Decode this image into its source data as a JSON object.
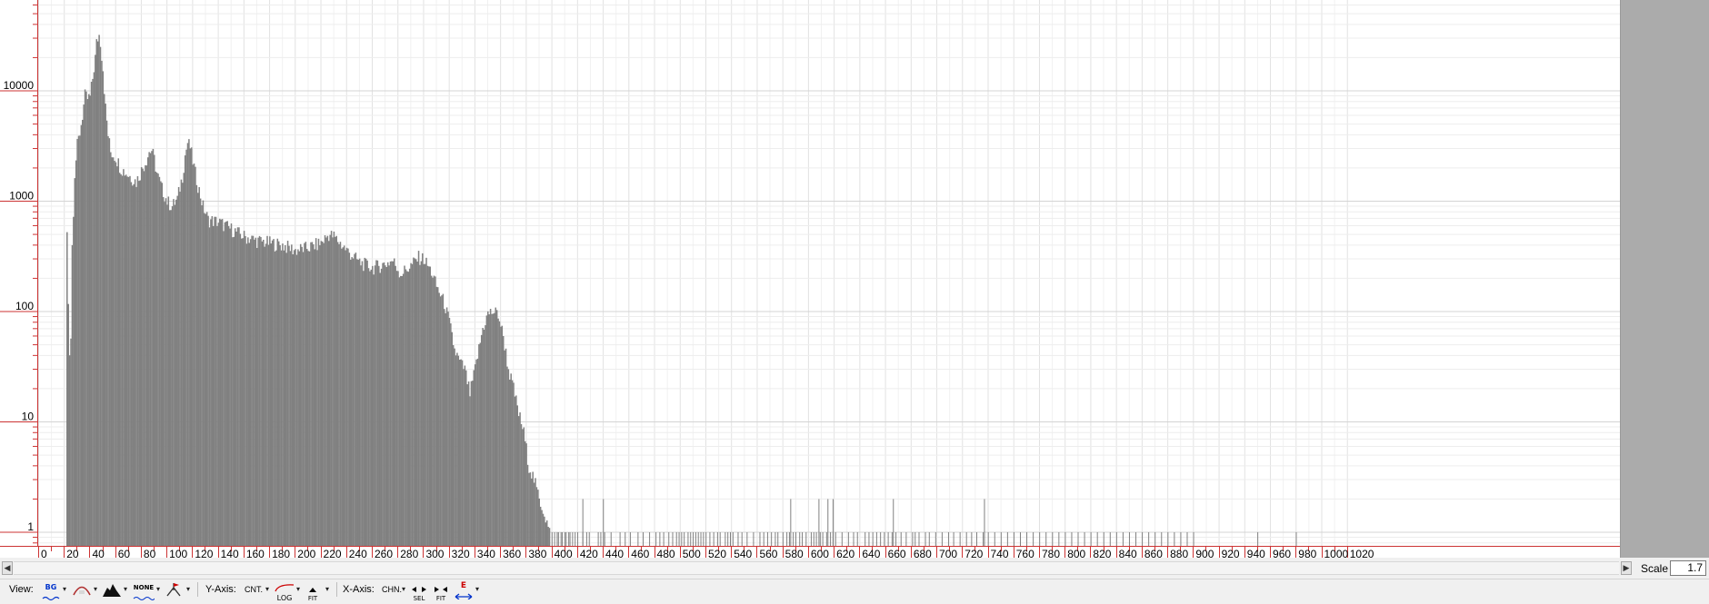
{
  "chart_data": {
    "type": "bar",
    "y_scale": "log",
    "ylim": [
      0.6,
      70000
    ],
    "xlim": [
      0,
      1020
    ],
    "grid": true,
    "bar_color": "#808080",
    "xticks": [
      "0",
      "20",
      "40",
      "60",
      "80",
      "100",
      "120",
      "140",
      "160",
      "180",
      "200",
      "220",
      "240",
      "260",
      "280",
      "300",
      "320",
      "340",
      "360",
      "380",
      "400",
      "420",
      "440",
      "460",
      "480",
      "500",
      "520",
      "540",
      "560",
      "580",
      "600",
      "620",
      "640",
      "660",
      "680",
      "700",
      "720",
      "740",
      "760",
      "780",
      "800",
      "820",
      "840",
      "860",
      "880",
      "900",
      "920",
      "940",
      "960",
      "980",
      "1000",
      "1020"
    ],
    "yticks": [
      "10000",
      "1000",
      "100",
      "10",
      "1"
    ],
    "profile": [
      [
        22,
        500
      ],
      [
        23,
        120
      ],
      [
        24,
        45
      ],
      [
        25,
        60
      ],
      [
        26,
        400
      ],
      [
        28,
        1800
      ],
      [
        30,
        3200
      ],
      [
        32,
        4200
      ],
      [
        34,
        6000
      ],
      [
        36,
        9000
      ],
      [
        38,
        8500
      ],
      [
        40,
        8800
      ],
      [
        42,
        13000
      ],
      [
        44,
        20000
      ],
      [
        45,
        27000
      ],
      [
        46,
        30000
      ],
      [
        47,
        32000
      ],
      [
        48,
        28000
      ],
      [
        50,
        16000
      ],
      [
        52,
        7000
      ],
      [
        54,
        4000
      ],
      [
        56,
        2800
      ],
      [
        60,
        2500
      ],
      [
        64,
        2000
      ],
      [
        68,
        1800
      ],
      [
        72,
        1650
      ],
      [
        76,
        1500
      ],
      [
        80,
        1900
      ],
      [
        84,
        2400
      ],
      [
        86,
        2800
      ],
      [
        88,
        2900
      ],
      [
        90,
        2400
      ],
      [
        92,
        1800
      ],
      [
        96,
        1300
      ],
      [
        100,
        1000
      ],
      [
        104,
        900
      ],
      [
        108,
        1050
      ],
      [
        112,
        1700
      ],
      [
        114,
        2600
      ],
      [
        116,
        3400
      ],
      [
        118,
        3100
      ],
      [
        120,
        2300
      ],
      [
        124,
        1400
      ],
      [
        128,
        900
      ],
      [
        132,
        680
      ],
      [
        140,
        650
      ],
      [
        150,
        560
      ],
      [
        160,
        480
      ],
      [
        170,
        440
      ],
      [
        180,
        420
      ],
      [
        190,
        400
      ],
      [
        200,
        360
      ],
      [
        210,
        380
      ],
      [
        220,
        420
      ],
      [
        226,
        500
      ],
      [
        230,
        480
      ],
      [
        240,
        360
      ],
      [
        250,
        280
      ],
      [
        260,
        250
      ],
      [
        270,
        270
      ],
      [
        276,
        290
      ],
      [
        282,
        220
      ],
      [
        290,
        260
      ],
      [
        296,
        310
      ],
      [
        300,
        300
      ],
      [
        306,
        230
      ],
      [
        310,
        170
      ],
      [
        316,
        120
      ],
      [
        320,
        80
      ],
      [
        324,
        45
      ],
      [
        328,
        35
      ],
      [
        332,
        30
      ],
      [
        336,
        18
      ],
      [
        340,
        30
      ],
      [
        346,
        70
      ],
      [
        350,
        95
      ],
      [
        354,
        100
      ],
      [
        358,
        95
      ],
      [
        362,
        60
      ],
      [
        366,
        30
      ],
      [
        370,
        20
      ],
      [
        374,
        12
      ],
      [
        378,
        8
      ],
      [
        382,
        4
      ],
      [
        386,
        3
      ],
      [
        390,
        2
      ],
      [
        394,
        1.5
      ],
      [
        398,
        1
      ]
    ],
    "sparse_x": [
      400,
      402,
      404,
      405,
      407,
      408,
      410,
      411,
      413,
      414,
      416,
      418,
      420,
      424,
      427,
      429,
      436,
      438,
      441,
      446,
      453,
      457,
      461,
      467,
      471,
      476,
      481,
      484,
      487,
      491,
      494,
      497,
      499,
      501,
      503,
      506,
      508,
      510,
      512,
      514,
      516,
      518,
      520,
      523,
      526,
      529,
      531,
      535,
      537,
      539,
      541,
      545,
      548,
      552,
      557,
      562,
      565,
      568,
      571,
      574,
      576,
      580,
      583,
      585,
      588,
      590,
      593,
      595,
      598,
      602,
      604,
      606,
      609,
      611,
      614,
      617,
      619,
      621,
      626,
      631,
      635,
      638,
      644,
      647,
      650,
      653,
      656,
      659,
      662,
      665,
      668,
      672,
      676,
      681,
      683,
      686,
      691,
      694,
      699,
      704,
      709,
      713,
      718,
      723,
      727,
      731,
      736,
      740,
      745,
      750,
      755,
      760,
      765,
      770,
      775,
      780,
      785,
      790,
      795,
      800,
      805,
      810,
      815,
      820,
      825,
      830,
      835,
      840,
      845,
      850,
      855,
      860,
      865,
      870,
      875,
      880,
      885,
      890,
      895,
      900,
      950,
      980
    ],
    "sparse_two_x": [
      424,
      440,
      586,
      608,
      615,
      619,
      666,
      737
    ]
  },
  "ui": {
    "scroll": {
      "left_arrow": "◀",
      "right_arrow": "▶"
    },
    "scale": {
      "label": "Scale",
      "value": "1.7"
    },
    "toolbar": {
      "view_label": "View:",
      "bg_label": "BG",
      "none_label": "NONE",
      "yaxis_label": "Y-Axis:",
      "cnt_label": "CNT.",
      "log_label": "LOG",
      "fit_label": "FIT",
      "xaxis_label": "X-Axis:",
      "chn_label": "CHN.",
      "sel_label": "SEL",
      "fit2_label": "FIT",
      "e_label": "E",
      "dd_arrow": "▾"
    }
  }
}
